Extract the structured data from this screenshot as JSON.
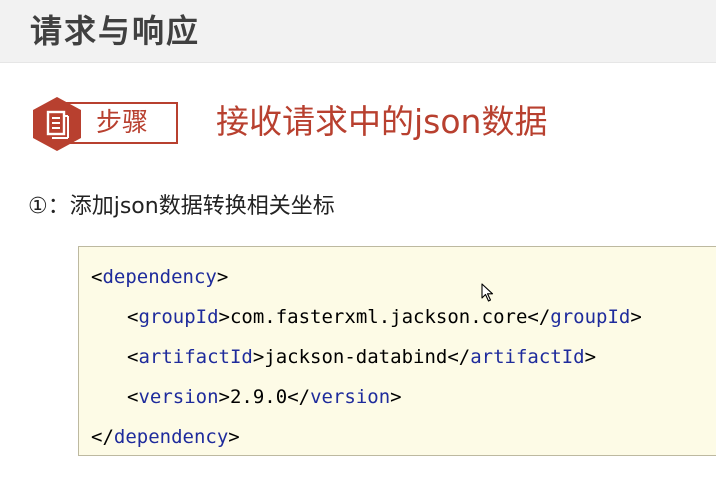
{
  "header": {
    "title": "请求与响应"
  },
  "step": {
    "badge_label": "步骤",
    "icon": "document-list-icon",
    "title": "接收请求中的json数据"
  },
  "sub_step": {
    "text": "①：添加json数据转换相关坐标"
  },
  "code": {
    "line1": {
      "open": "<",
      "tag": "dependency",
      "close": ">"
    },
    "line2": {
      "open1": "<",
      "tag1": "groupId",
      "close1": ">",
      "value": "com.fasterxml.jackson.core",
      "open2": "</",
      "tag2": "groupId",
      "close2": ">"
    },
    "line3": {
      "open1": "<",
      "tag1": "artifactId",
      "close1": ">",
      "value": "jackson-databind",
      "open2": "</",
      "tag2": "artifactId",
      "close2": ">"
    },
    "line4": {
      "open1": "<",
      "tag1": "version",
      "close1": ">",
      "value": "2.9.0",
      "open2": "</",
      "tag2": "version",
      "close2": ">"
    },
    "line5": {
      "open": "</",
      "tag": "dependency",
      "close": ">"
    }
  },
  "colors": {
    "accent": "#b8402f",
    "tag": "#1e2b9c",
    "code_background": "#fdfbe6",
    "title": "#404040"
  },
  "cursor": {
    "icon": "mouse-pointer-icon"
  }
}
